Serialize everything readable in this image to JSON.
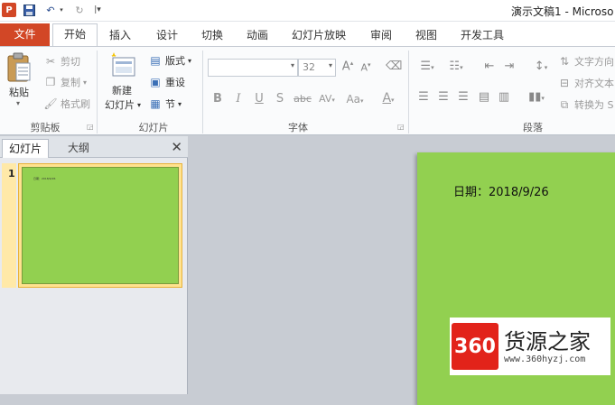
{
  "window": {
    "title": "演示文稿1 - Microso",
    "app_icon": "P",
    "qat": [
      {
        "name": "save-icon",
        "glyph": "💾"
      },
      {
        "name": "undo-icon",
        "glyph": "↶"
      },
      {
        "name": "redo-icon",
        "glyph": "↷"
      },
      {
        "name": "customize-qat-icon",
        "glyph": "▾"
      }
    ]
  },
  "tabs": [
    {
      "label": "文件"
    },
    {
      "label": "开始"
    },
    {
      "label": "插入"
    },
    {
      "label": "设计"
    },
    {
      "label": "切换"
    },
    {
      "label": "动画"
    },
    {
      "label": "幻灯片放映"
    },
    {
      "label": "审阅"
    },
    {
      "label": "视图"
    },
    {
      "label": "开发工具"
    }
  ],
  "ribbon": {
    "clipboard": {
      "label": "剪贴板",
      "paste": "粘贴",
      "cut": "剪切",
      "copy": "复制",
      "format_painter": "格式刷"
    },
    "slides": {
      "label": "幻灯片",
      "new_slide_line1": "新建",
      "new_slide_line2": "幻灯片",
      "layout": "版式",
      "reset": "重设",
      "section": "节"
    },
    "font": {
      "label": "字体",
      "font_name": "",
      "font_size": "32",
      "bold": "B",
      "italic": "I",
      "underline": "U",
      "shadow": "S",
      "strike": "abc",
      "spacing": "AV",
      "case": "Aa",
      "grow": "A",
      "shrink": "A",
      "color": "A"
    },
    "paragraph": {
      "label": "段落",
      "text_direction": "文字方向",
      "align_text": "对齐文本",
      "convert_smartart": "转换为 S"
    }
  },
  "panel": {
    "tab_slides": "幻灯片",
    "tab_outline": "大纲",
    "close": "✕",
    "thumb_number": "1",
    "thumb_text": "日期：2018/9/26"
  },
  "slide": {
    "date_text": "日期：2018/9/26",
    "background": "#92d050"
  },
  "watermark": {
    "logo": "360",
    "title": "货源之家",
    "url": "www.360hyzj.com"
  }
}
